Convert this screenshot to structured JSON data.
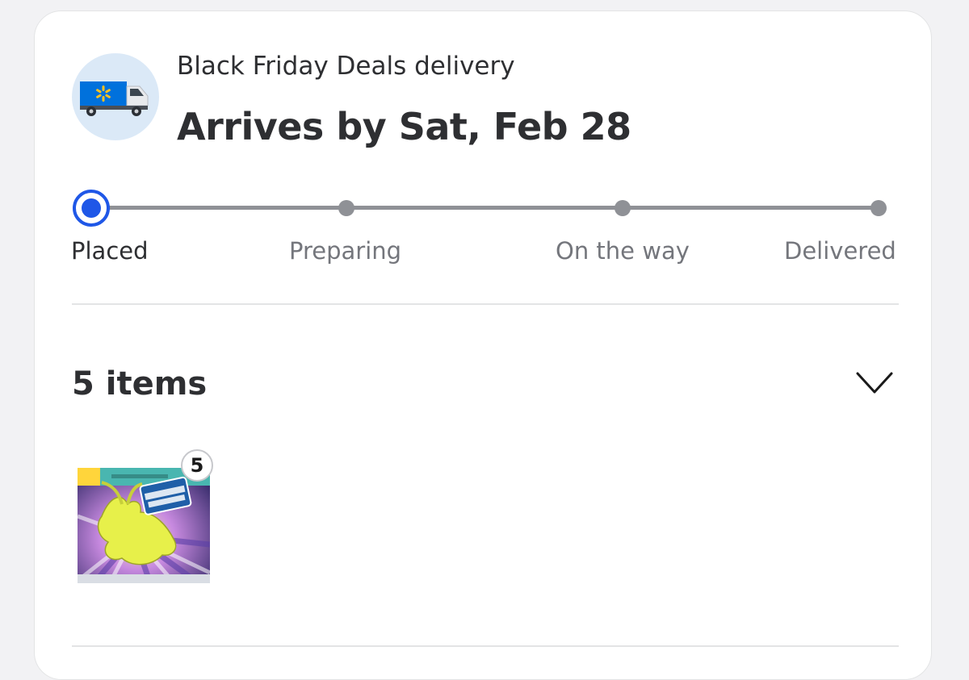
{
  "delivery": {
    "subtitle": "Black Friday Deals delivery",
    "title": "Arrives by Sat, Feb 28"
  },
  "tracker": {
    "steps": [
      {
        "label": "Placed",
        "state": "current"
      },
      {
        "label": "Preparing",
        "state": "upcoming"
      },
      {
        "label": "On the way",
        "state": "upcoming"
      },
      {
        "label": "Delivered",
        "state": "upcoming"
      }
    ],
    "active_color": "#1f57e7",
    "inactive_color": "#8f9196"
  },
  "items": {
    "count_label": "5 items",
    "products": [
      {
        "quantity": "5",
        "image": "pokemon-ascended-heroes-elite-trainer-box"
      }
    ]
  },
  "icons": {
    "delivery": "walmart-truck-icon",
    "expand": "chevron-down-icon"
  },
  "colors": {
    "walmart_blue": "#0071dc",
    "walmart_spark": "#ffc220",
    "icon_bg": "#dbe9f7"
  }
}
